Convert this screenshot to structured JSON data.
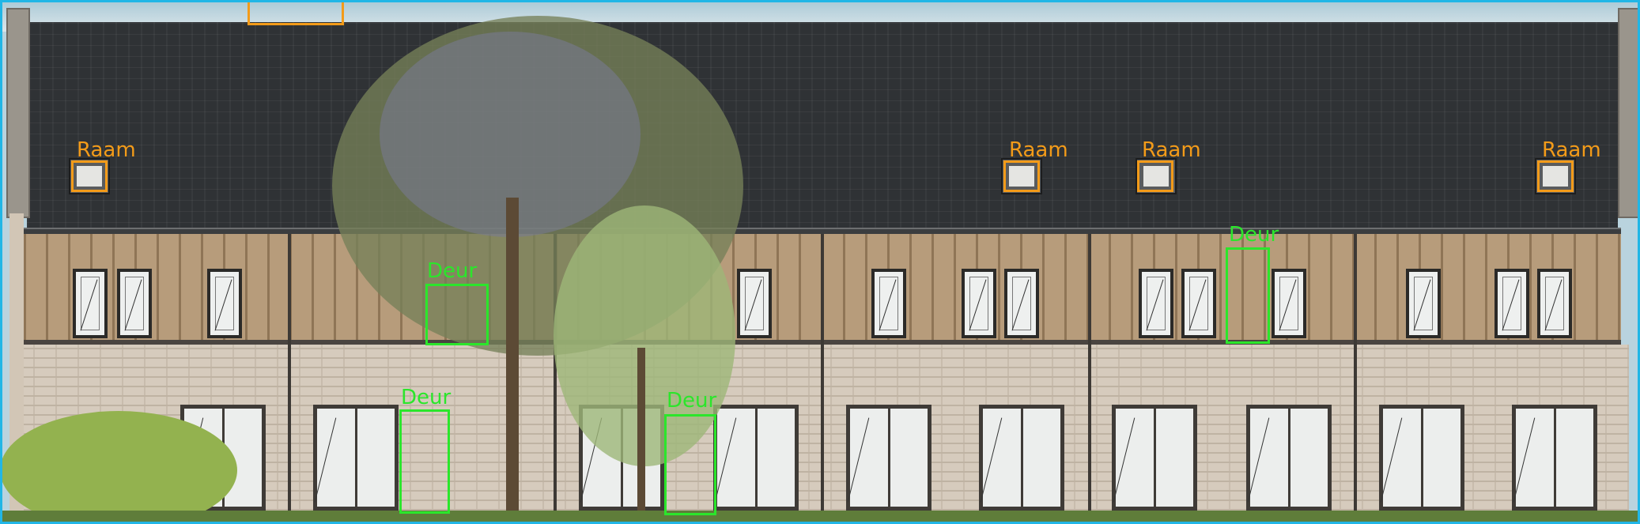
{
  "detections": [
    {
      "label": "Raam"
    },
    {
      "label": "Raam"
    },
    {
      "label": "Raam"
    },
    {
      "label": "Raam"
    },
    {
      "label": "Deur"
    },
    {
      "label": "Deur"
    },
    {
      "label": "Deur"
    },
    {
      "label": "Deur"
    }
  ],
  "colors": {
    "raam_box": "#f39b19",
    "deur_box": "#2be62b",
    "image_border": "#21b6e6",
    "roof": "#2f3235",
    "wood_cladding": "#a88d6d",
    "brick": "#d6cbbd"
  }
}
